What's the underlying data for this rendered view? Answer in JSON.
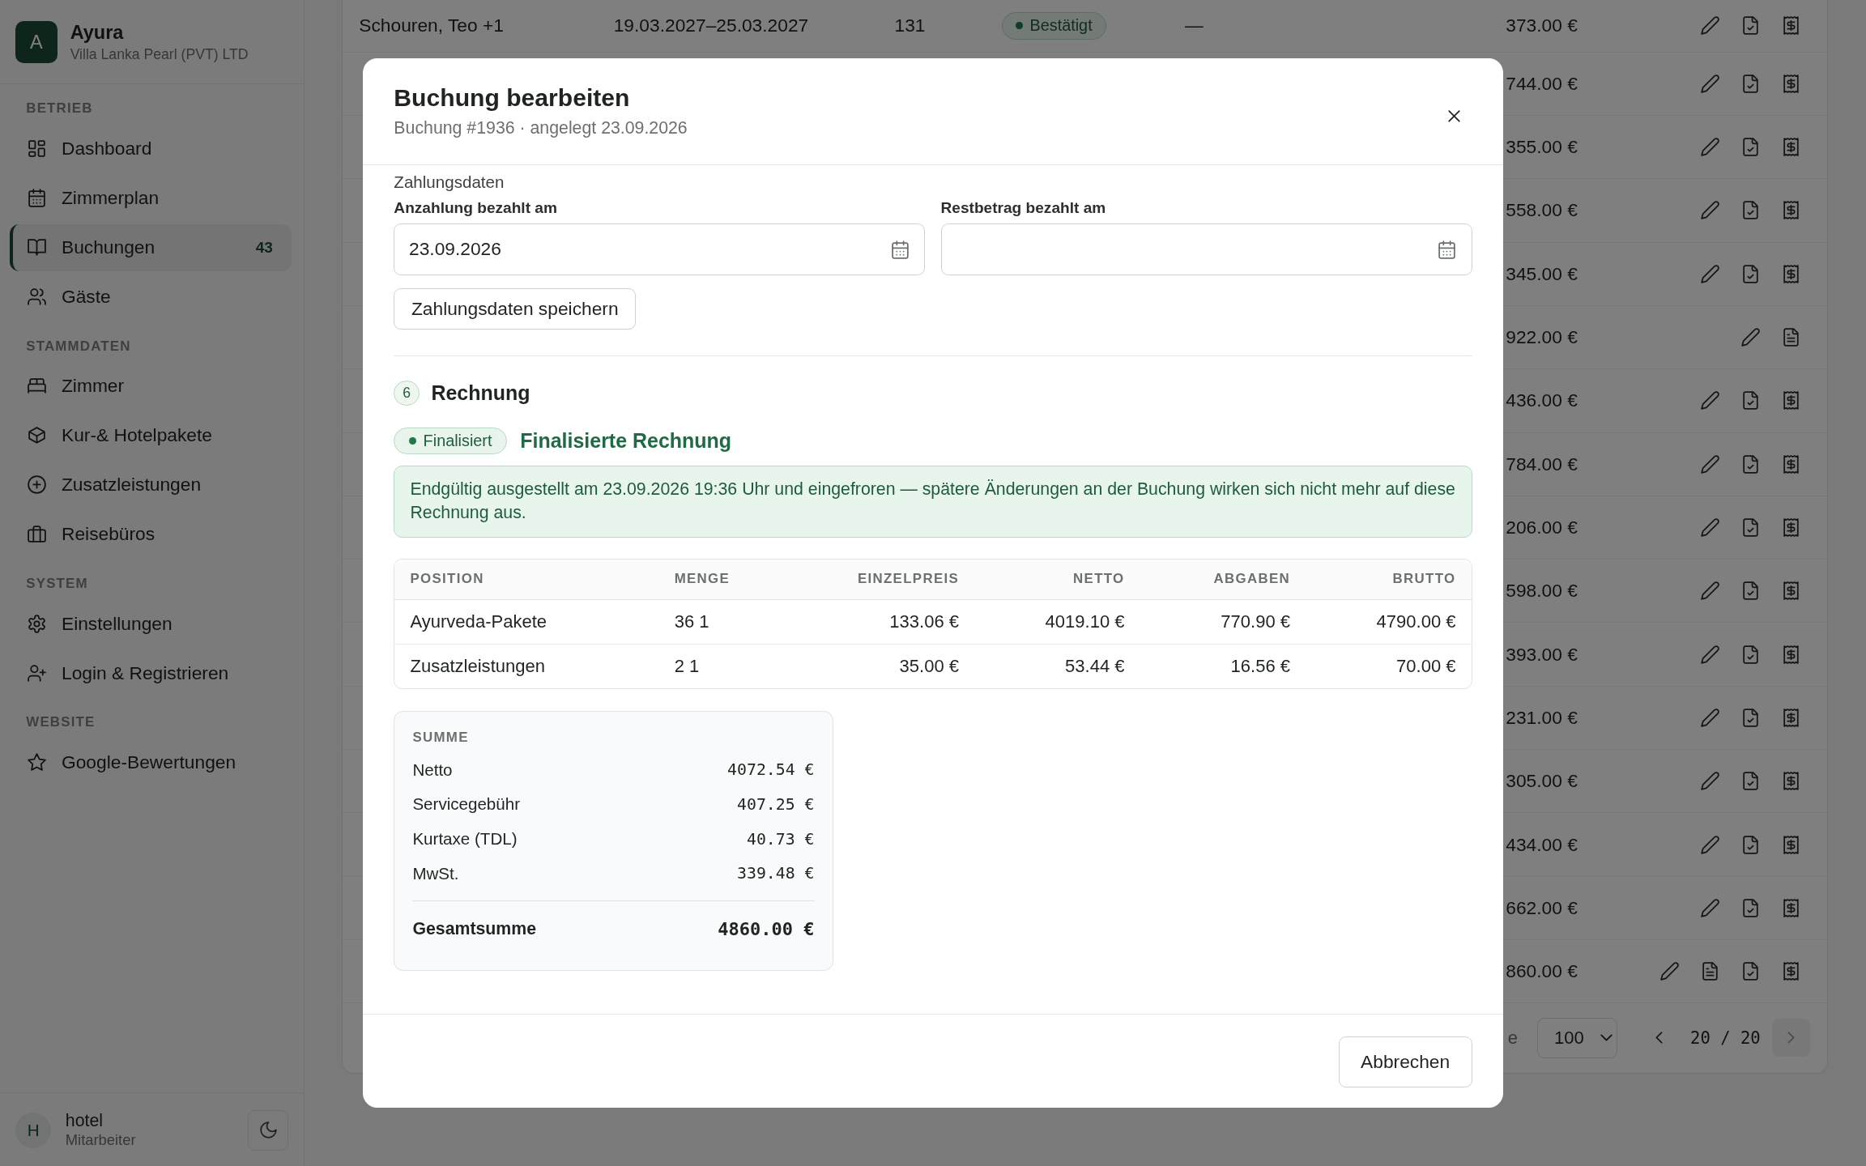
{
  "sidebar": {
    "brand": {
      "initial": "A",
      "name": "Ayura",
      "company": "Villa Lanka Pearl (PVT) LTD"
    },
    "sections": [
      {
        "title": "BETRIEB",
        "items": [
          {
            "label": "Dashboard",
            "selected": false
          },
          {
            "label": "Zimmerplan",
            "selected": false
          },
          {
            "label": "Buchungen",
            "selected": true,
            "count": "43"
          },
          {
            "label": "Gäste",
            "selected": false
          }
        ]
      },
      {
        "title": "STAMMDATEN",
        "items": [
          {
            "label": "Zimmer",
            "selected": false
          },
          {
            "label": "Kur-& Hotelpakete",
            "selected": false
          },
          {
            "label": "Zusatzleistungen",
            "selected": false
          },
          {
            "label": "Reisebüros",
            "selected": false
          }
        ]
      },
      {
        "title": "SYSTEM",
        "items": [
          {
            "label": "Einstellungen",
            "selected": false
          },
          {
            "label": "Login & Registrieren",
            "selected": false
          }
        ]
      },
      {
        "title": "WEBSITE",
        "items": [
          {
            "label": "Google-Bewertungen",
            "selected": false
          }
        ]
      }
    ],
    "user": {
      "initial": "H",
      "name": "hotel",
      "role": "Mitarbeiter"
    }
  },
  "bookings_table": {
    "rows": [
      {
        "guest": "Schouren, Teo +1",
        "dates": "19.03.2027–25.03.2027",
        "nights": "131",
        "status": "Bestätigt",
        "column_5": "—",
        "amount": "373.00 €",
        "actions": [
          {
            "kind": "edit"
          },
          {
            "kind": "document-check"
          },
          {
            "kind": "receipt"
          }
        ]
      },
      {
        "amount": "744.00 €",
        "actions": [
          {
            "kind": "edit"
          },
          {
            "kind": "document-check"
          },
          {
            "kind": "receipt"
          }
        ]
      },
      {
        "amount": "355.00 €",
        "actions": [
          {
            "kind": "edit"
          },
          {
            "kind": "document-check"
          },
          {
            "kind": "receipt"
          }
        ]
      },
      {
        "amount": "558.00 €",
        "actions": [
          {
            "kind": "edit"
          },
          {
            "kind": "document-check"
          },
          {
            "kind": "receipt"
          }
        ]
      },
      {
        "amount": "345.00 €",
        "actions": [
          {
            "kind": "edit"
          },
          {
            "kind": "document-check"
          },
          {
            "kind": "receipt"
          }
        ]
      },
      {
        "amount": "922.00 €",
        "actions": [
          {
            "kind": "edit"
          },
          {
            "kind": "document"
          }
        ]
      },
      {
        "amount": "436.00 €",
        "actions": [
          {
            "kind": "edit"
          },
          {
            "kind": "document-check"
          },
          {
            "kind": "receipt"
          }
        ]
      },
      {
        "amount": "784.00 €",
        "actions": [
          {
            "kind": "edit"
          },
          {
            "kind": "document-check"
          },
          {
            "kind": "receipt"
          }
        ]
      },
      {
        "amount": "206.00 €",
        "actions": [
          {
            "kind": "edit"
          },
          {
            "kind": "document-check"
          },
          {
            "kind": "receipt"
          }
        ]
      },
      {
        "amount": "598.00 €",
        "actions": [
          {
            "kind": "edit"
          },
          {
            "kind": "document-check"
          },
          {
            "kind": "receipt"
          }
        ]
      },
      {
        "amount": "393.00 €",
        "actions": [
          {
            "kind": "edit"
          },
          {
            "kind": "document-check"
          },
          {
            "kind": "receipt"
          }
        ]
      },
      {
        "amount": "231.00 €",
        "actions": [
          {
            "kind": "edit"
          },
          {
            "kind": "document-check"
          },
          {
            "kind": "receipt"
          }
        ]
      },
      {
        "amount": "305.00 €",
        "actions": [
          {
            "kind": "edit"
          },
          {
            "kind": "document-check"
          },
          {
            "kind": "receipt"
          }
        ]
      },
      {
        "amount": "434.00 €",
        "actions": [
          {
            "kind": "edit"
          },
          {
            "kind": "document-check"
          },
          {
            "kind": "receipt"
          }
        ]
      },
      {
        "amount": "662.00 €",
        "actions": [
          {
            "kind": "edit"
          },
          {
            "kind": "document-check"
          },
          {
            "kind": "receipt"
          }
        ]
      },
      {
        "amount": "860.00 €",
        "actions": [
          {
            "kind": "edit"
          },
          {
            "kind": "document"
          },
          {
            "kind": "document-check"
          },
          {
            "kind": "receipt"
          }
        ]
      }
    ],
    "footer": {
      "label": "e",
      "page_size": "100",
      "page": "20 / 20"
    }
  },
  "dialog": {
    "title": "Buchung bearbeiten",
    "subtitle": "Buchung #1936 · angelegt 23.09.2026",
    "payment": {
      "heading": "Zahlungsdaten",
      "fields": [
        {
          "label": "Anzahlung bezahlt am",
          "value": "23.09.2026"
        },
        {
          "label": "Restbetrag bezahlt am"
        }
      ],
      "save_button": "Zahlungsdaten speichern"
    },
    "invoice": {
      "step": "6",
      "heading": "Rechnung",
      "badge": "Finalisiert",
      "title": "Finalisierte Rechnung",
      "notice": "Endgültig ausgestellt am 23.09.2026 19:36 Uhr und eingefroren — spätere Änderungen an der Buchung wirken sich nicht mehr auf diese Rechnung aus.",
      "table": {
        "columns": [
          "POSITION",
          "MENGE",
          "EINZELPREIS",
          "NETTO",
          "ABGABEN",
          "BRUTTO"
        ],
        "rows": [
          [
            "Ayurveda-Pakete",
            "36 1",
            "133.06 €",
            "4019.10 €",
            "770.90 €",
            "4790.00 €"
          ],
          [
            "Zusatzleistungen",
            "2 1",
            "35.00 €",
            "53.44 €",
            "16.56 €",
            "70.00 €"
          ]
        ]
      },
      "summary": {
        "title": "SUMME",
        "lines": [
          {
            "label": "Netto",
            "value": "4072.54 €"
          },
          {
            "label": "Servicegebühr",
            "value": "407.25 €"
          },
          {
            "label": "Kurtaxe (TDL)",
            "value": "40.73 €"
          },
          {
            "label": "MwSt.",
            "value": "339.48 €"
          }
        ],
        "total": {
          "label": "Gesamtsumme",
          "value": "4860.00 €"
        }
      }
    },
    "cancel_button": "Abbrechen"
  }
}
